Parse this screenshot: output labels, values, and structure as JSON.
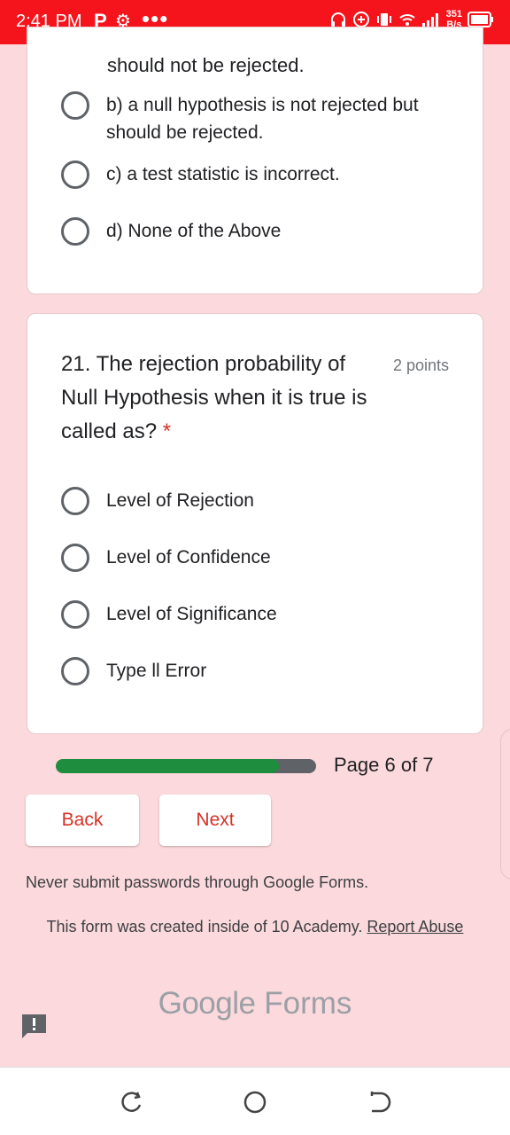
{
  "status_bar": {
    "time": "2:41 PM",
    "app_icon": "P",
    "net_rate_top": "351",
    "net_rate_bottom": "B/s"
  },
  "card_prev": {
    "cut_text": "should not be rejected.",
    "options": [
      "b) a null hypothesis is not rejected but should be rejected.",
      "c) a test statistic is incorrect.",
      "d) None of the Above"
    ]
  },
  "question": {
    "title": "21. The rejection probability of Null Hypothesis when it is true is called as?",
    "required_mark": "*",
    "points": "2 points",
    "options": [
      "Level of Rejection",
      "Level of Confidence",
      "Level of Significance",
      "Type ll Error"
    ]
  },
  "progress": {
    "fraction": 0.857,
    "label": "Page 6 of 7"
  },
  "buttons": {
    "back": "Back",
    "next": "Next"
  },
  "footer": {
    "warning": "Never submit passwords through Google Forms.",
    "created_prefix": "This form was created inside of 10 Academy.",
    "report_link": "Report Abuse",
    "brand_google": "Google",
    "brand_forms": "Forms"
  },
  "colors": {
    "accent": "#d93025",
    "progress_fill": "#1e8e3e",
    "background": "#fcd9dc",
    "status_bar": "#f5141c"
  }
}
